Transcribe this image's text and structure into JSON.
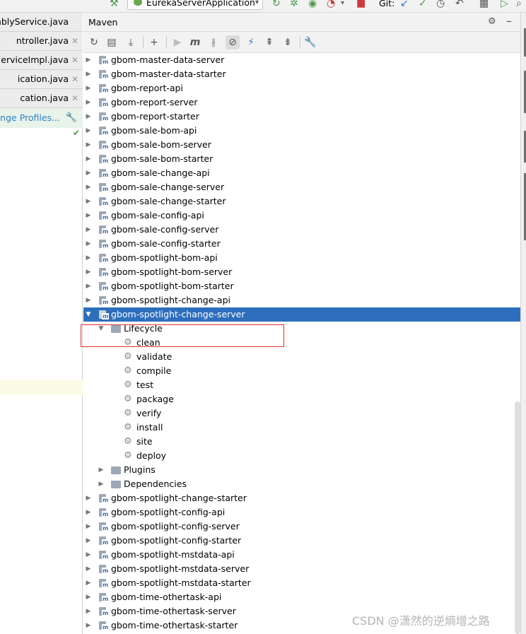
{
  "toolbar": {
    "run_config": "EurekaServerApplication",
    "git_label": "Git:",
    "icons": [
      "hammer-icon",
      "rerun-icon",
      "debug-icon",
      "coverage-icon",
      "stop-icon",
      "git-update-icon",
      "git-commit-icon",
      "history-icon",
      "rollback-icon",
      "project-structure-icon",
      "terminal-icon"
    ]
  },
  "editor_tabs": [
    {
      "label": "mblyService.java"
    },
    {
      "label": "ntroller.java"
    },
    {
      "label": "erviceImpl.java"
    },
    {
      "label": "ication.java"
    },
    {
      "label": "cation.java"
    }
  ],
  "profiles_banner": "ange Profiles...",
  "maven": {
    "title": "Maven",
    "toolbar_icons": [
      "reload-icon",
      "add-folder-icon",
      "download-icon",
      "add-icon",
      "run-icon",
      "maven-goal-icon",
      "toggle-offline-icon",
      "skip-tests-icon",
      "lightning-icon",
      "expand-all-icon",
      "collapse-all-icon",
      "settings-wrench-icon"
    ],
    "tree_before": [
      "gbom-master-data-server",
      "gbom-master-data-starter",
      "gbom-report-api",
      "gbom-report-server",
      "gbom-report-starter",
      "gbom-sale-bom-api",
      "gbom-sale-bom-server",
      "gbom-sale-bom-starter",
      "gbom-sale-change-api",
      "gbom-sale-change-server",
      "gbom-sale-change-starter",
      "gbom-sale-config-api",
      "gbom-sale-config-server",
      "gbom-sale-config-starter",
      "gbom-spotlight-bom-api",
      "gbom-spotlight-bom-server",
      "gbom-spotlight-bom-starter",
      "gbom-spotlight-change-api"
    ],
    "selected_module": "gbom-spotlight-change-server",
    "lifecycle_label": "Lifecycle",
    "lifecycle_phases": [
      "clean",
      "validate",
      "compile",
      "test",
      "package",
      "verify",
      "install",
      "site",
      "deploy"
    ],
    "plugins_label": "Plugins",
    "dependencies_label": "Dependencies",
    "tree_after": [
      "gbom-spotlight-change-starter",
      "gbom-spotlight-config-api",
      "gbom-spotlight-config-server",
      "gbom-spotlight-config-starter",
      "gbom-spotlight-mstdata-api",
      "gbom-spotlight-mstdata-server",
      "gbom-spotlight-mstdata-starter",
      "gbom-time-othertask-api",
      "gbom-time-othertask-server",
      "gbom-time-othertask-starter"
    ]
  },
  "watermark": "CSDN @潇然的逆熵增之路",
  "colors": {
    "selection": "#2d6fbd",
    "highlight_box": "#e03030",
    "profiles_text": "#2f7fc4"
  }
}
